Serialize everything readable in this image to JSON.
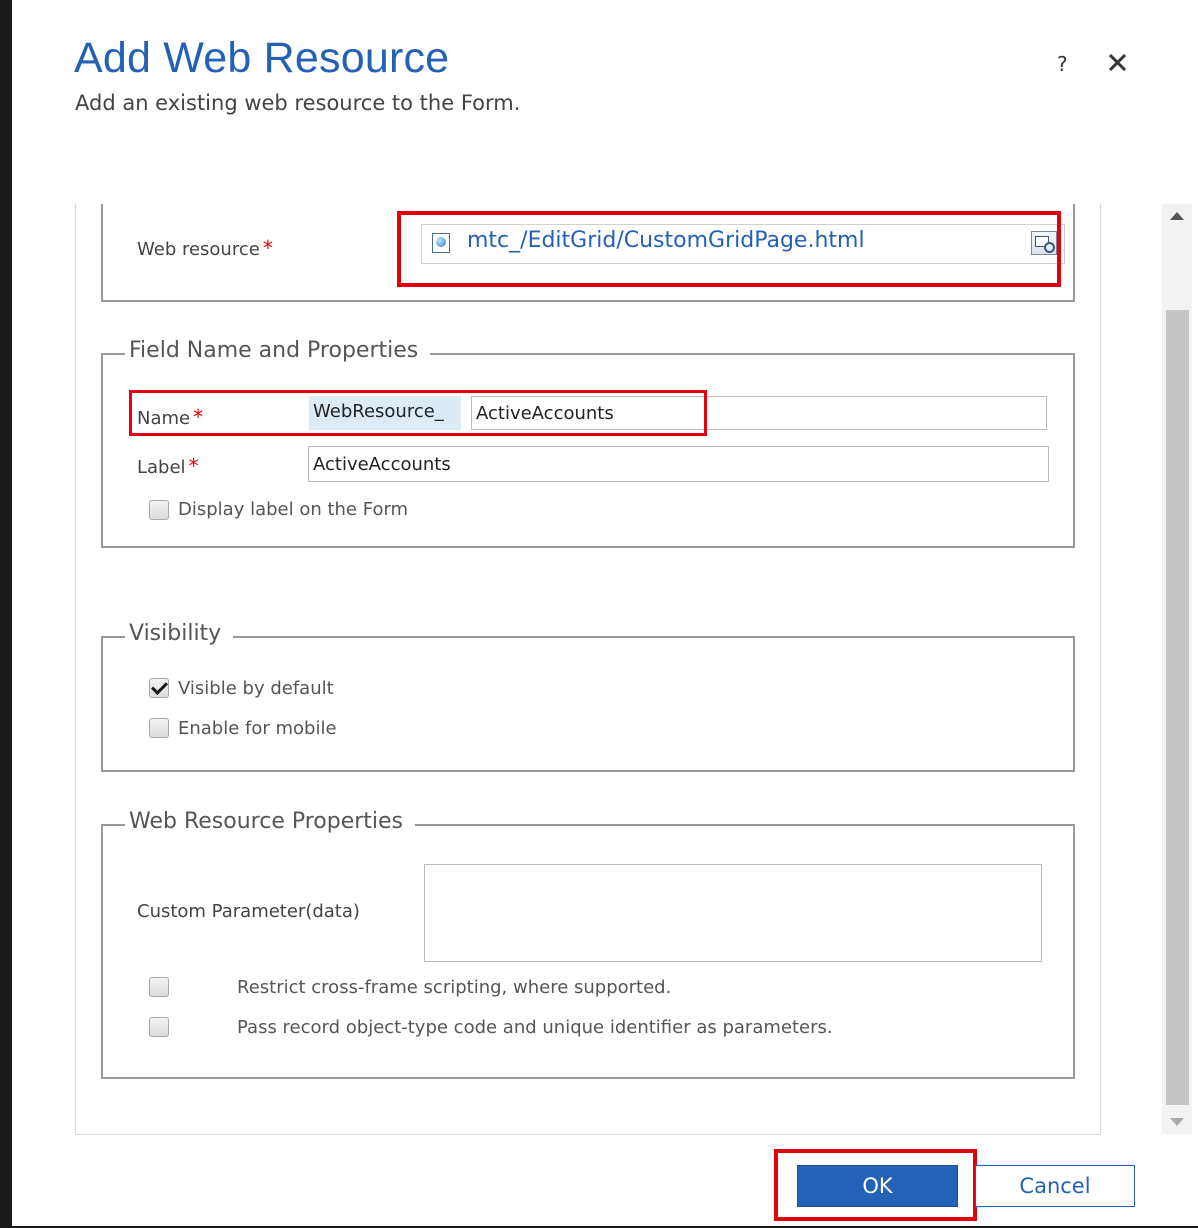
{
  "dialog": {
    "title": "Add Web Resource",
    "subtitle": "Add an existing web resource to the Form.",
    "help_glyph": "?",
    "close_icon": "close-icon"
  },
  "general": {
    "web_resource_label": "Web resource",
    "required_mark": "*",
    "web_resource_value": "mtc_/EditGrid/CustomGridPage.html",
    "web_resource_icon": "html-file-icon",
    "lookup_icon": "lookup-icon"
  },
  "field_properties": {
    "legend": "Field Name and Properties",
    "name_label": "Name",
    "name_prefix": "WebResource_",
    "name_value": "ActiveAccounts",
    "label_label": "Label",
    "label_value": "ActiveAccounts",
    "display_label_text": "Display label on the Form",
    "display_label_checked": false
  },
  "visibility": {
    "legend": "Visibility",
    "visible_by_default_text": "Visible by default",
    "visible_by_default_checked": true,
    "enable_mobile_text": "Enable for mobile",
    "enable_mobile_checked": false
  },
  "web_resource_properties": {
    "legend": "Web Resource Properties",
    "custom_param_label": "Custom Parameter(data)",
    "custom_param_value": "",
    "restrict_text": "Restrict cross-frame scripting, where supported.",
    "restrict_checked": false,
    "pass_record_text": "Pass record object-type code and unique identifier as parameters.",
    "pass_record_checked": false
  },
  "footer": {
    "ok_label": "OK",
    "cancel_label": "Cancel"
  },
  "colors": {
    "title_blue": "#2461b6",
    "required_red": "#e00000",
    "highlight_red": "#e3000f",
    "ok_bg": "#2462b7"
  }
}
